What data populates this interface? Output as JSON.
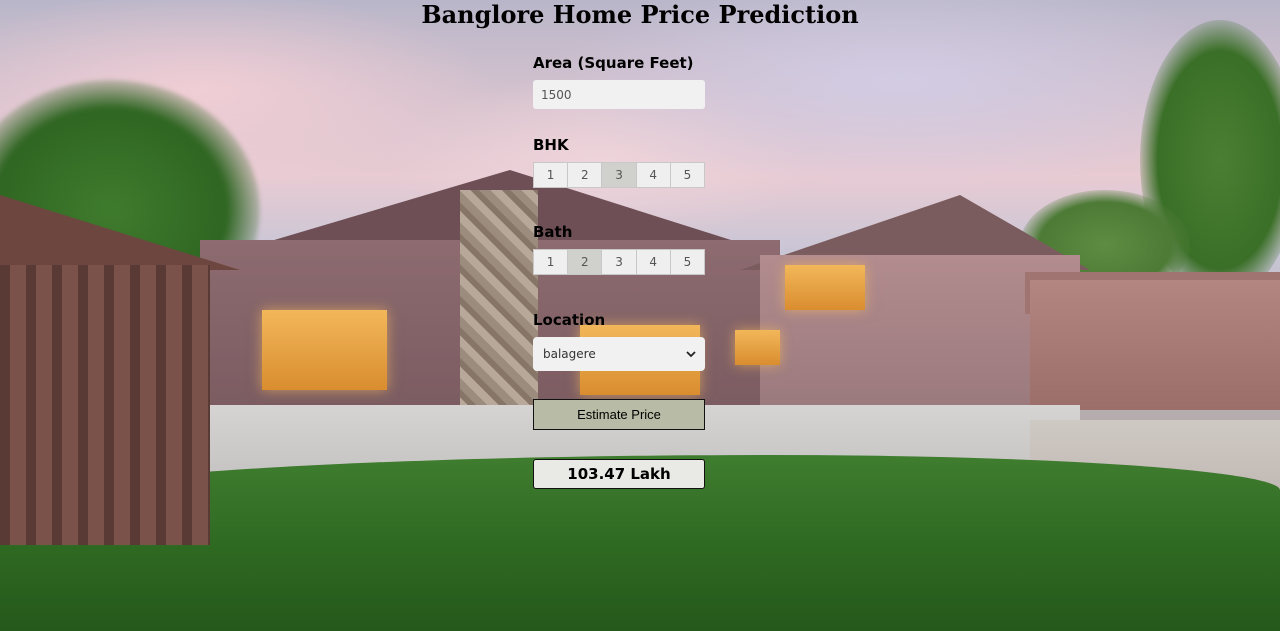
{
  "page": {
    "title": "Banglore Home Price Prediction"
  },
  "form": {
    "area": {
      "label": "Area (Square Feet)",
      "value": "1500"
    },
    "bhk": {
      "label": "BHK",
      "options": [
        "1",
        "2",
        "3",
        "4",
        "5"
      ],
      "selected": "3"
    },
    "bath": {
      "label": "Bath",
      "options": [
        "1",
        "2",
        "3",
        "4",
        "5"
      ],
      "selected": "2"
    },
    "location": {
      "label": "Location",
      "selected": "balagere"
    },
    "estimate_button": "Estimate Price",
    "result": "103.47 Lakh"
  },
  "colors": {
    "button_bg": "#b8bba5",
    "input_bg": "#f1f1f1",
    "segment_active": "#d0d0cc"
  },
  "icons": {
    "select_arrow": "chevron-down-icon"
  }
}
